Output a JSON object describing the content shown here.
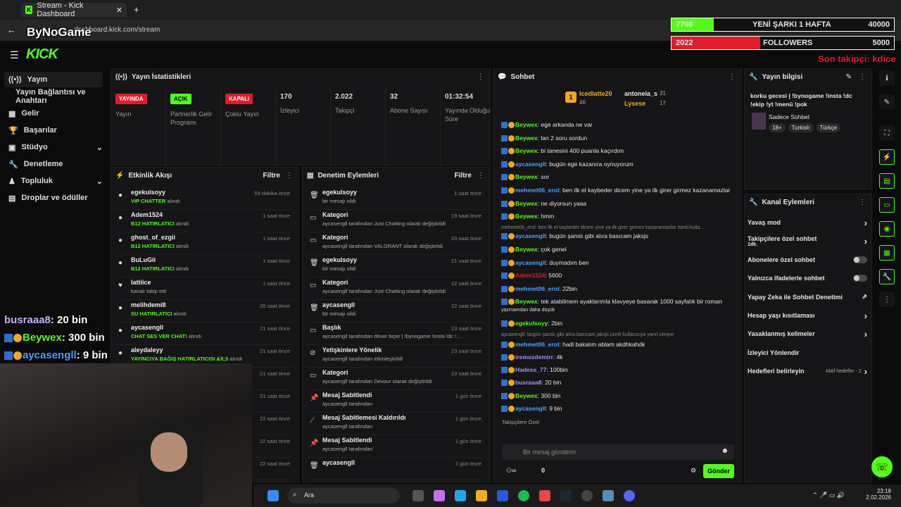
{
  "browser": {
    "tab_title": "Stream - Kick Dashboard",
    "url": "dashboard.kick.com/stream",
    "new_tab": "+"
  },
  "overlay": {
    "watermark": "ByNoGame",
    "goal1_left": "7700",
    "goal1_label": "YENİ ŞARKI 1 HAFTA",
    "goal1_right": "40000",
    "goal1_progress": 0.19,
    "goal2_left": "2022",
    "goal2_label": "FOLLOWERS",
    "goal2_right": "5000",
    "goal2_progress": 0.4,
    "last_follower": "Son takipçi: kdice",
    "cam_lines": [
      {
        "name": "busraaa8",
        "text": ": 20 bin"
      },
      {
        "name": "Beywex",
        "text": ": 300 bin"
      },
      {
        "name": "aycasengll",
        "text": ": 9 bin"
      }
    ]
  },
  "logo": "KICK",
  "sidebar": [
    {
      "label": "Yayın",
      "icon": "broadcast-icon"
    },
    {
      "label": "Yayın Bağlantısı ve Anahtarı",
      "icon": ""
    },
    {
      "label": "Gelir",
      "icon": "revenue-icon"
    },
    {
      "label": "Başarılar",
      "icon": "trophy-icon"
    },
    {
      "label": "Stüdyo",
      "icon": "studio-icon"
    },
    {
      "label": "Denetleme",
      "icon": "moderation-icon"
    },
    {
      "label": "Topluluk",
      "icon": "community-icon"
    },
    {
      "label": "Droplar ve ödüller",
      "icon": "drops-icon"
    }
  ],
  "stats": {
    "title": "Yayın İstatistikleri",
    "cells": [
      {
        "badge": "YAYINDA",
        "label": "Yayın",
        "kind": "red"
      },
      {
        "badge": "AÇIK",
        "label": "Partnerlik Gelir Programı",
        "kind": "grn"
      },
      {
        "badge": "KAPALI",
        "label": "Çoklu Yayın",
        "kind": "red"
      },
      {
        "value": "170",
        "label": "İzleyici"
      },
      {
        "value": "2.022",
        "label": "Takipçi"
      },
      {
        "value": "32",
        "label": "Abone Sayısı"
      },
      {
        "value": "01:32:54",
        "label": "Yayında Olduğu Süre"
      }
    ]
  },
  "activity": {
    "title": "Etkinlik Akışı",
    "filter": "Filtre",
    "rows": [
      {
        "name": "egekulsoyy",
        "action": "VIP CHATTER",
        "suffix": " alındı",
        "time": "59 dakika önce"
      },
      {
        "name": "Adem1524",
        "action": "B12 HATIRLATICI",
        "suffix": " alındı",
        "time": "1 saat önce"
      },
      {
        "name": "ghost_of_ezgii",
        "action": "B12 HATIRLATICI",
        "suffix": " alındı",
        "time": "1 saat önce"
      },
      {
        "name": "BuLuGii",
        "action": "B12 HATIRLATICI",
        "suffix": " alındı",
        "time": "1 saat önce"
      },
      {
        "name": "lattiice",
        "action": "",
        "suffix": "kanalı takip etti",
        "time": "1 saat önce"
      },
      {
        "name": "melihdemi8",
        "action": "SU HATIRLATICI",
        "suffix": " alındı",
        "time": "20 saat önce"
      },
      {
        "name": "aycasengll",
        "action": "CHAT SES VER CHAT!",
        "suffix": " alındı",
        "time": "21 saat önce"
      },
      {
        "name": "aleydaleyy",
        "action": "YAYINCIYA BAĞIŞ HATIRLATICISI &lt;3",
        "suffix": " alındı",
        "time": "21 saat önce"
      },
      {
        "name": "",
        "action": "",
        "suffix": "",
        "time": "21 saat önce"
      },
      {
        "name": "",
        "action": "",
        "suffix": "",
        "time": "21 saat önce"
      },
      {
        "name": "",
        "action": "",
        "suffix": "",
        "time": "22 saat önce"
      },
      {
        "name": "",
        "action": "",
        "suffix": "",
        "time": "22 saat önce"
      },
      {
        "name": "",
        "action": "",
        "suffix": "",
        "time": "22 saat önce"
      }
    ]
  },
  "moderation": {
    "title": "Denetim Eylemleri",
    "filter": "Filtre",
    "rows": [
      {
        "name": "egekulsoyy",
        "sub": "bir mesajı sildi",
        "time": "1 saat önce"
      },
      {
        "name": "Kategori",
        "sub": "aycasengll tarafından Just Chatting olarak değiştirildi",
        "time": "19 saat önce"
      },
      {
        "name": "Kategori",
        "sub": "aycasengll tarafından VALORANT olarak değiştirildi",
        "time": "20 saat önce"
      },
      {
        "name": "egekulsoyy",
        "sub": "bir mesajı sildi",
        "time": "21 saat önce"
      },
      {
        "name": "Kategori",
        "sub": "aycasengll tarafından Just Chatting olarak değiştirildi",
        "time": "22 saat önce"
      },
      {
        "name": "aycasengll",
        "sub": "bir mesajı sildi",
        "time": "22 saat önce"
      },
      {
        "name": "Başlık",
        "sub": "aycasengll tarafından döver biçer | !bynogame !insta !dc !ekip !yt !menü !pok olarak değiştirildi",
        "time": "23 saat önce"
      },
      {
        "name": "Yetişkinlere Yönelik",
        "sub": "aycasengll tarafından etkinleştirildi",
        "time": "23 saat önce"
      },
      {
        "name": "Kategori",
        "sub": "aycasengll tarafından Devour olarak değiştirildi",
        "time": "23 saat önce"
      },
      {
        "name": "Mesaj Sabitlendi",
        "sub": "aycasengll tarafından",
        "time": "1 gün önce"
      },
      {
        "name": "Mesaj Sabitlemesi Kaldırıldı",
        "sub": "aycasengll tarafından",
        "time": "1 gün önce"
      },
      {
        "name": "Mesaj Sabitlendi",
        "sub": "aycasengll tarafından",
        "time": "1 gün önce"
      },
      {
        "name": "aycasengll",
        "sub": "",
        "time": "1 gün önce"
      }
    ]
  },
  "chat": {
    "title": "Sohbet",
    "top1": "Icedlatte20",
    "top1_val": "46",
    "top2": "antonela_s",
    "top2_val": "31",
    "top3": "Lysese",
    "top3_val": "17",
    "input_placeholder": "Bir mesaj gönderin",
    "send": "Gönder",
    "viewers": "0",
    "follower_only": "Takipçilere Özel",
    "lines": [
      {
        "u": "Beywex",
        "c": "#53fc18",
        "t": ": ege arkanda ne var"
      },
      {
        "u": "Beywex",
        "c": "#53fc18",
        "t": ": lan 2 soru sordun"
      },
      {
        "u": "Beywex",
        "c": "#53fc18",
        "t": ": bi tanesini 400 puanla kaçırdım"
      },
      {
        "u": "aycasengll",
        "c": "#4aa3ff",
        "t": ": bugün ege kazanıra oynuyorum"
      },
      {
        "u": "Beywex",
        "c": "#53fc18",
        "t": ": sor"
      },
      {
        "u": "mehmet06_erol",
        "c": "#4aa3ff",
        "t": ": ben ilk el kaybeder dicem yine ya ilk girer girmez kazanamazlar"
      },
      {
        "u": "Beywex",
        "c": "#53fc18",
        "t": ": ne diyorsun yaaa"
      },
      {
        "u": "Beywex",
        "c": "#53fc18",
        "t": ": hmm"
      },
      {
        "u": "",
        "c": "#888",
        "t": "mehmet06_erol: ben ilk el kaybeder dicem yine ya ilk girer girmez kazanamazlar isimli kulla..."
      },
      {
        "u": "aycasengll",
        "c": "#4aa3ff",
        "t": ": bugün şanslı gibi alıra basıcam jaksjs"
      },
      {
        "u": "Beywex",
        "c": "#53fc18",
        "t": ": çok genel"
      },
      {
        "u": "aycasengll",
        "c": "#4aa3ff",
        "t": ": duymadım ben"
      },
      {
        "u": "Adem1524",
        "c": "#e21b2b",
        "t": ": 5600"
      },
      {
        "u": "mehmet06_erol",
        "c": "#4aa3ff",
        "t": ": 22bin"
      },
      {
        "u": "Beywex",
        "c": "#53fc18",
        "t": ": tek atabilmem ayaklarımla klavyeye basarak 1000 sayfalık bir roman"
      },
      {
        "u": "",
        "c": "#ddd",
        "t": "yazmamdan daha düşük"
      },
      {
        "u": "egekulsoyy",
        "c": "#53fc18",
        "t": ": 2bin"
      },
      {
        "u": "",
        "c": "#888",
        "t": "aycasengll: bugün şanslı gibi alıra basıcam jaksjs isimli kullanıcıya yanıt veriyor"
      },
      {
        "u": "mehmet06_erol",
        "c": "#4aa3ff",
        "t": ": hadi bakalım ablam akdhkahdk"
      },
      {
        "u": "iremozdemirr",
        "c": "#a78bfa",
        "t": ": 4k"
      },
      {
        "u": "Hadess_77",
        "c": "#a78bfa",
        "t": ": 100bin"
      },
      {
        "u": "busraaa8",
        "c": "#a78bfa",
        "t": ": 20 bin"
      },
      {
        "u": "Beywex",
        "c": "#53fc18",
        "t": ": 300 bin"
      },
      {
        "u": "aycasengll",
        "c": "#4aa3ff",
        "t": ": 9 bin"
      }
    ]
  },
  "info": {
    "title": "Yayın bilgisi",
    "stream_title": "korku gecesi | !bynogame !insta !dc !ekip !yt !menü !pok",
    "category": "Sadece Sohbet",
    "tags": [
      "18+",
      "Turkish",
      "Türkçe"
    ]
  },
  "channel": {
    "title": "Kanal Eylemleri",
    "items": [
      {
        "label": "Yavaş mod",
        "ctl": "chev"
      },
      {
        "label": "Takipçilere özel sohbet",
        "sub": "1dk.",
        "ctl": "chev"
      },
      {
        "label": "Abonelere özel sohbet",
        "ctl": "toggle"
      },
      {
        "label": "Yalnızca ifadelerle sohbet",
        "ctl": "toggle"
      },
      {
        "label": "Yapay Zeka ile Sohbet Denetimi",
        "ctl": "ext"
      },
      {
        "label": "Hesap yaşı kısıtlaması",
        "ctl": "chev"
      },
      {
        "label": "Yasaklanmış kelimeler",
        "ctl": "chev"
      },
      {
        "label": "İzleyici Yönlendir",
        "ctl": ""
      },
      {
        "label": "Hedefleri belirleyin",
        "sub2": "Aktif hedefler - 2",
        "ctl": "chev"
      }
    ]
  },
  "taskbar": {
    "search": "Ara",
    "time": "23:18",
    "date": "2.02.2026"
  }
}
